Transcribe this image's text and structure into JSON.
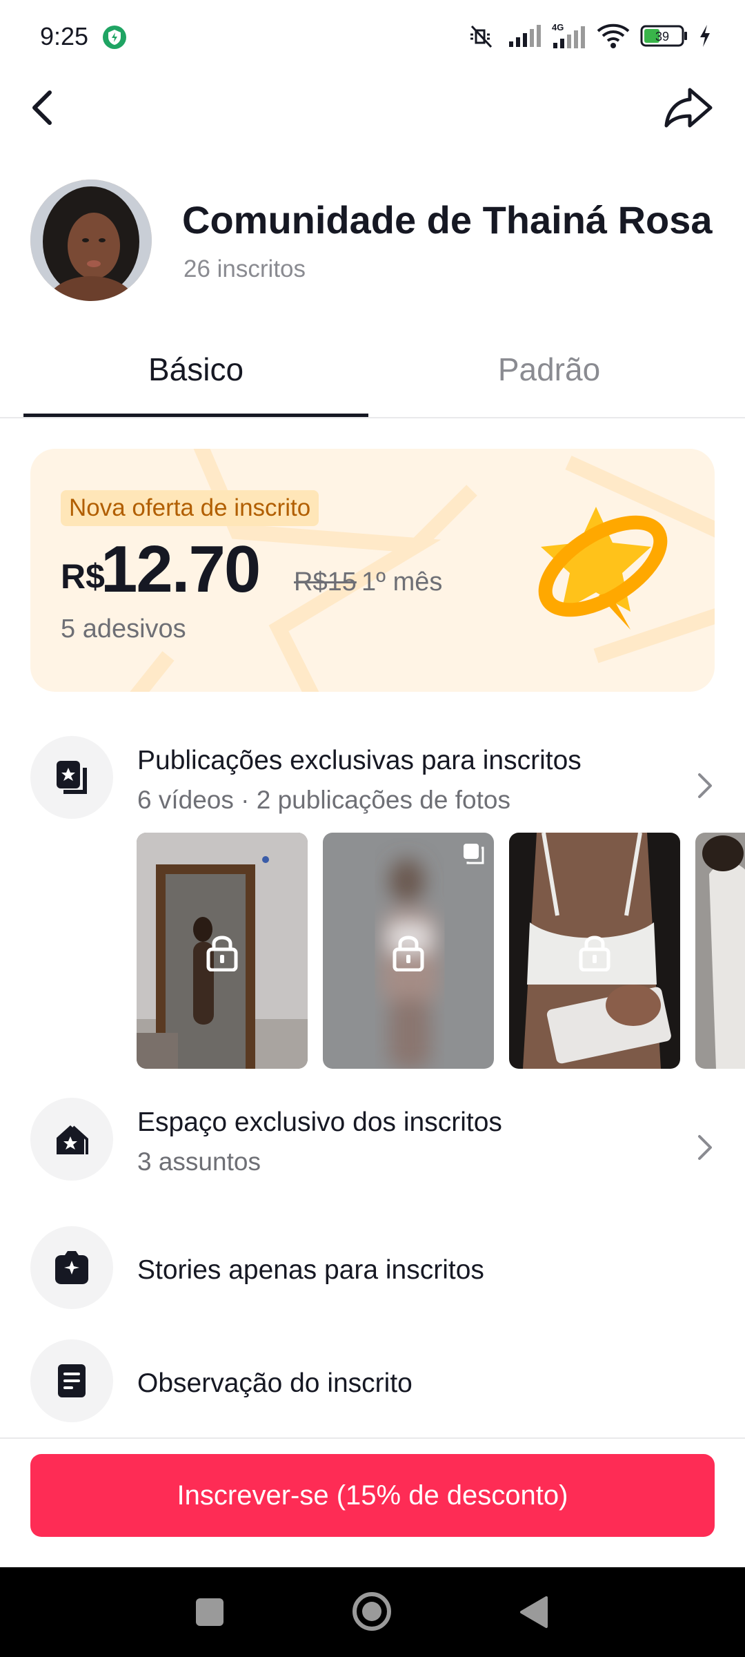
{
  "status_bar": {
    "time": "9:25",
    "battery_level": "39",
    "icons": [
      "vpn-shield-icon",
      "mute-icon",
      "signal-icon",
      "4g-signal-icon",
      "wifi-icon",
      "battery-icon",
      "charging-icon"
    ]
  },
  "header": {
    "back_icon": "back-icon",
    "share_icon": "share-icon"
  },
  "profile": {
    "title": "Comunidade de Thainá Rosa",
    "subscribers": "26 inscritos"
  },
  "tabs": [
    {
      "label": "Básico",
      "selected": true
    },
    {
      "label": "Padrão",
      "selected": false
    }
  ],
  "offer": {
    "badge": "Nova oferta de inscrito",
    "currency": "R$",
    "price": "12.70",
    "old_price": "R$15",
    "period": "1º mês",
    "stickers": "5 adesivos"
  },
  "features": [
    {
      "title": "Publicações exclusivas para inscritos",
      "subtitle": "6 vídeos · 2 publicações de fotos",
      "icon": "exclusive-posts-icon",
      "has_chevron": true
    },
    {
      "title": "Espaço exclusivo dos inscritos",
      "subtitle": "3 assuntos",
      "icon": "exclusive-space-icon",
      "has_chevron": true
    },
    {
      "title": "Stories apenas para inscritos",
      "subtitle": "",
      "icon": "stories-icon",
      "has_chevron": false
    },
    {
      "title": "Observação do inscrito",
      "subtitle": "",
      "icon": "note-icon",
      "has_chevron": false
    }
  ],
  "thumbnails": [
    {
      "locked": true,
      "multi_photo": false
    },
    {
      "locked": true,
      "multi_photo": true
    },
    {
      "locked": true,
      "multi_photo": false
    },
    {
      "locked": false,
      "multi_photo": false
    }
  ],
  "subscribe_button": "Inscrever-se (15% de desconto)",
  "colors": {
    "accent": "#fe2c55",
    "offer_bg": "#fff4e5",
    "badge_bg": "#ffe6b8",
    "badge_text": "#b15e00",
    "star": "#ffb400"
  }
}
